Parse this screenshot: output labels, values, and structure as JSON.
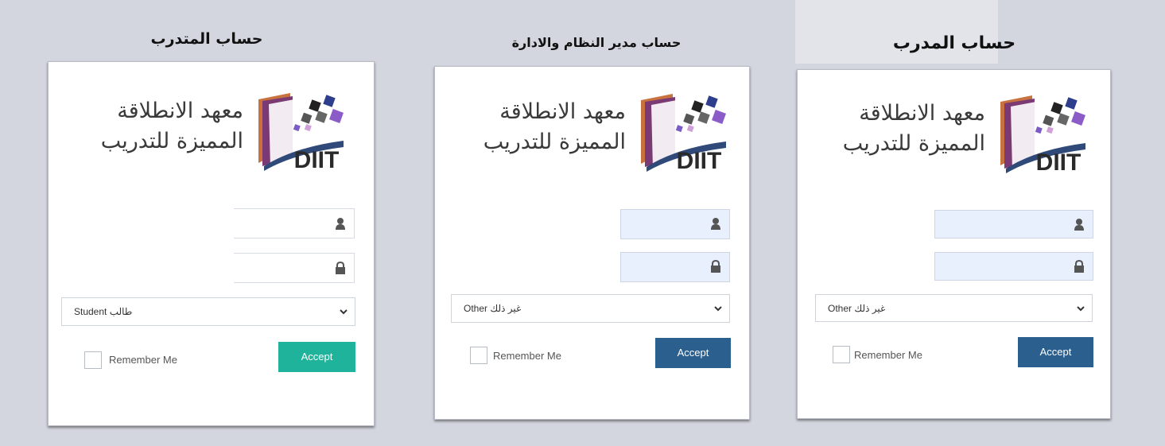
{
  "titles": {
    "trainee": "حساب المتدرب",
    "admin": "حساب مدير النظام والادارة",
    "trainer": "حساب المدرب"
  },
  "logo": {
    "line1": "معهد الانطلاقة",
    "line2": "المميزة للتدريب",
    "brand": "DIIT"
  },
  "forms": {
    "trainee": {
      "role_value": "Student طالب",
      "remember_label": "Remember Me",
      "accept_label": "Accept"
    },
    "admin": {
      "role_value": "Other غير ذلك",
      "remember_label": "Remember Me",
      "accept_label": "Accept"
    },
    "trainer": {
      "role_value": "Other غير ذلك",
      "remember_label": "Remember Me",
      "accept_label": "Accept"
    }
  },
  "colors": {
    "accept_trainee": "#1fb39b",
    "accept_other": "#2b5f8e",
    "input_bg": "#e8effd"
  }
}
